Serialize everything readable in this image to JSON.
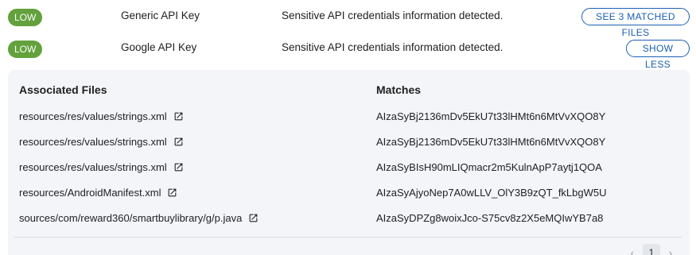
{
  "findings": [
    {
      "severity": "LOW",
      "name": "Generic API Key",
      "description": "Sensitive API credentials information detected.",
      "action_label": "SEE 3 MATCHED FILES"
    },
    {
      "severity": "LOW",
      "name": "Google API Key",
      "description": "Sensitive API credentials information detected.",
      "action_label": "SHOW LESS"
    }
  ],
  "colors": {
    "severity_low": "#62a13c",
    "accent": "#1a5fb4",
    "panel_bg": "#f3f5f9"
  },
  "details": {
    "files_header": "Associated Files",
    "matches_header": "Matches",
    "rows": [
      {
        "file": "resources/res/values/strings.xml",
        "match": "AIzaSyBj2136mDv5EkU7t33lHMt6n6MtVvXQO8Y"
      },
      {
        "file": "resources/res/values/strings.xml",
        "match": "AIzaSyBj2136mDv5EkU7t33lHMt6n6MtVvXQO8Y"
      },
      {
        "file": "resources/res/values/strings.xml",
        "match": "AIzaSyBIsH90mLIQmacr2m5KulnApP7aytj1QOA"
      },
      {
        "file": "resources/AndroidManifest.xml",
        "match": "AIzaSyAjyoNep7A0wLLV_OlY3B9zQT_fkLbgW5U"
      },
      {
        "file": "sources/com/reward360/smartbuylibrary/g/p.java",
        "match": "AIzaSyDPZg8woixJco-S75cv8z2X5eMQIwYB7a8"
      }
    ],
    "file_link_icon": "open-in-new-icon"
  },
  "pagination": {
    "current_page": "1",
    "prev_icon": "chevron-left-icon",
    "next_icon": "chevron-right-icon"
  }
}
